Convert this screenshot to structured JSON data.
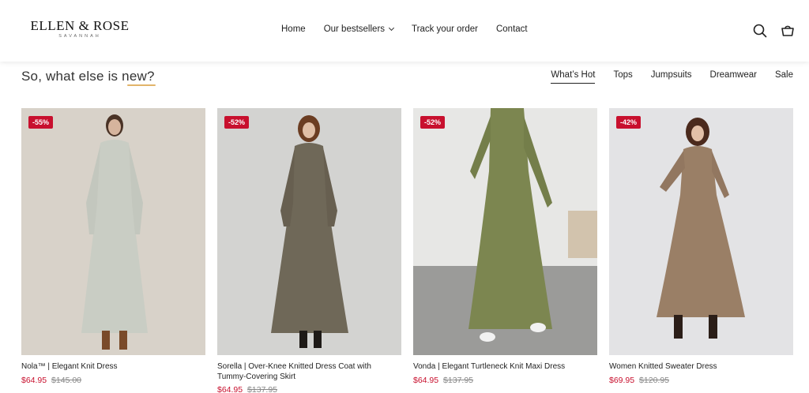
{
  "header": {
    "logo_main": "ELLEN & ROSE",
    "logo_sub": "SAVANNAH",
    "nav": [
      {
        "label": "Home"
      },
      {
        "label": "Our bestsellers"
      },
      {
        "label": "Track your order"
      },
      {
        "label": "Contact"
      }
    ],
    "icons": [
      "search-icon",
      "cart-icon"
    ]
  },
  "section": {
    "title": "So, what else is new?",
    "tabs": [
      {
        "label": "What’s Hot",
        "active": true
      },
      {
        "label": "Tops",
        "active": false
      },
      {
        "label": "Jumpsuits",
        "active": false
      },
      {
        "label": "Dreamwear",
        "active": false
      },
      {
        "label": "Sale",
        "active": false
      }
    ]
  },
  "products": [
    {
      "badge": "-55%",
      "name": "Nola™ | Elegant Knit Dress",
      "price": "$64.95",
      "original_price": "$145.00"
    },
    {
      "badge": "-52%",
      "name": "Sorella | Over-Knee Knitted Dress Coat with Tummy-Covering Skirt",
      "price": "$64.95",
      "original_price": "$137.95"
    },
    {
      "badge": "-52%",
      "name": "Vonda | Elegant Turtleneck Knit Maxi Dress",
      "price": "$64.95",
      "original_price": "$137.95"
    },
    {
      "badge": "-42%",
      "name": "Women Knitted Sweater Dress",
      "price": "$69.95",
      "original_price": "$120.95"
    }
  ],
  "colors": {
    "sale_red": "#c8102e",
    "accent_underline": "#e2b46a",
    "dress_1": "#c9cdc4",
    "dress_2": "#6f6858",
    "dress_3": "#7c8650",
    "dress_4": "#9a7f66"
  }
}
